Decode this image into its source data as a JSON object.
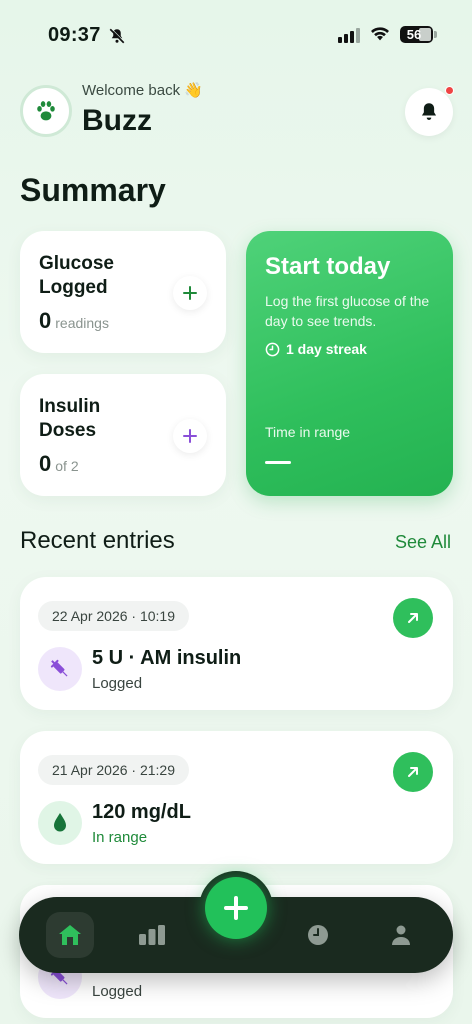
{
  "status_bar": {
    "time": "09:37",
    "battery": "56",
    "icons": [
      "bell-slash-icon",
      "signal-icon",
      "wifi-icon",
      "battery-icon"
    ]
  },
  "header": {
    "welcome": "Welcome back 👋",
    "name": "Buzz",
    "avatar_icon": "paw-icon",
    "notification_icon": "bell-icon"
  },
  "summary": {
    "title": "Summary",
    "glucose": {
      "title": "Glucose Logged",
      "count": "0",
      "unit": "readings"
    },
    "insulin": {
      "title": "Insulin Doses",
      "count": "0",
      "unit": "of 2"
    },
    "start": {
      "title": "Start today",
      "description": "Log the first glucose of the day to see trends.",
      "streak": "1 day streak",
      "time_in_range_label": "Time in range"
    }
  },
  "recent": {
    "title": "Recent entries",
    "see_all": "See All",
    "entries": [
      {
        "date": "22 Apr 2026 · 10:19",
        "value": "5 U · AM insulin",
        "status": "Logged",
        "icon": "syringe-icon"
      },
      {
        "date": "21 Apr 2026 · 21:29",
        "value": "120 mg/dL",
        "status": "In range",
        "icon": "drop-icon"
      },
      {
        "date": "",
        "value": "",
        "status": "Logged",
        "icon": "syringe-icon"
      }
    ]
  },
  "nav": {
    "items": [
      "home-icon",
      "stats-icon",
      "history-icon",
      "profile-icon"
    ],
    "fab_icon": "plus-icon"
  },
  "colors": {
    "accent": "#2fbf5c",
    "nav_bg": "#1a2a1f",
    "purple": "#8a4fd8"
  }
}
